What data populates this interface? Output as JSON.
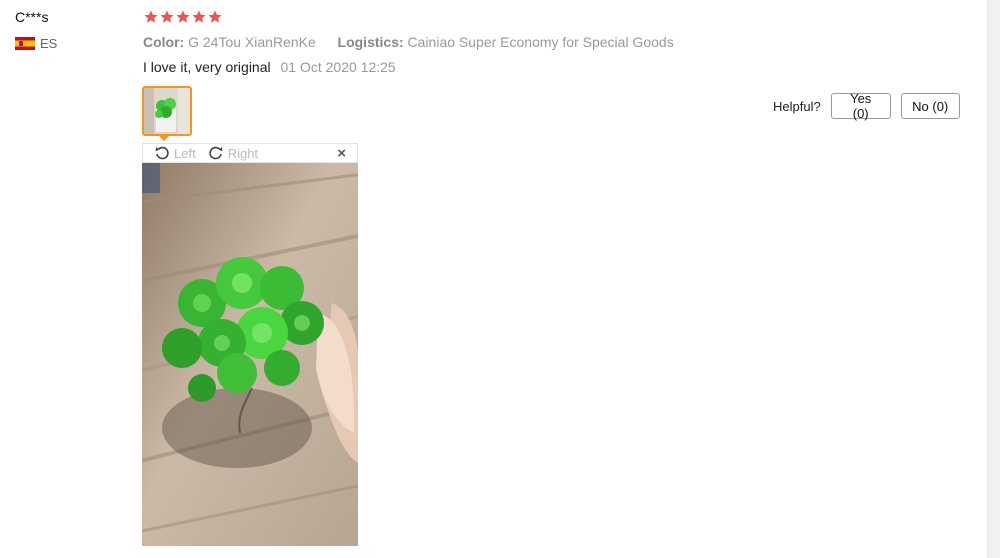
{
  "reviewer": {
    "name": "C***s",
    "country_code": "ES",
    "flag": "spain-flag"
  },
  "rating": {
    "stars": 5,
    "max": 5,
    "color": "#f0534f"
  },
  "sku": {
    "color_label": "Color:",
    "color_value": "G 24Tou XianRenKe",
    "logistics_label": "Logistics:",
    "logistics_value": "Cainiao Super Economy for Special Goods"
  },
  "review": {
    "text": "I love it, very original",
    "date": "01 Oct 2020 12:25"
  },
  "helpful": {
    "label": "Helpful?",
    "yes": "Yes (0)",
    "no": "No (0)"
  },
  "viewer": {
    "left_label": "Left",
    "right_label": "Right",
    "close": "×"
  },
  "colors": {
    "accent": "#f7931e",
    "muted_text": "#999999",
    "star": "#f0534f"
  }
}
